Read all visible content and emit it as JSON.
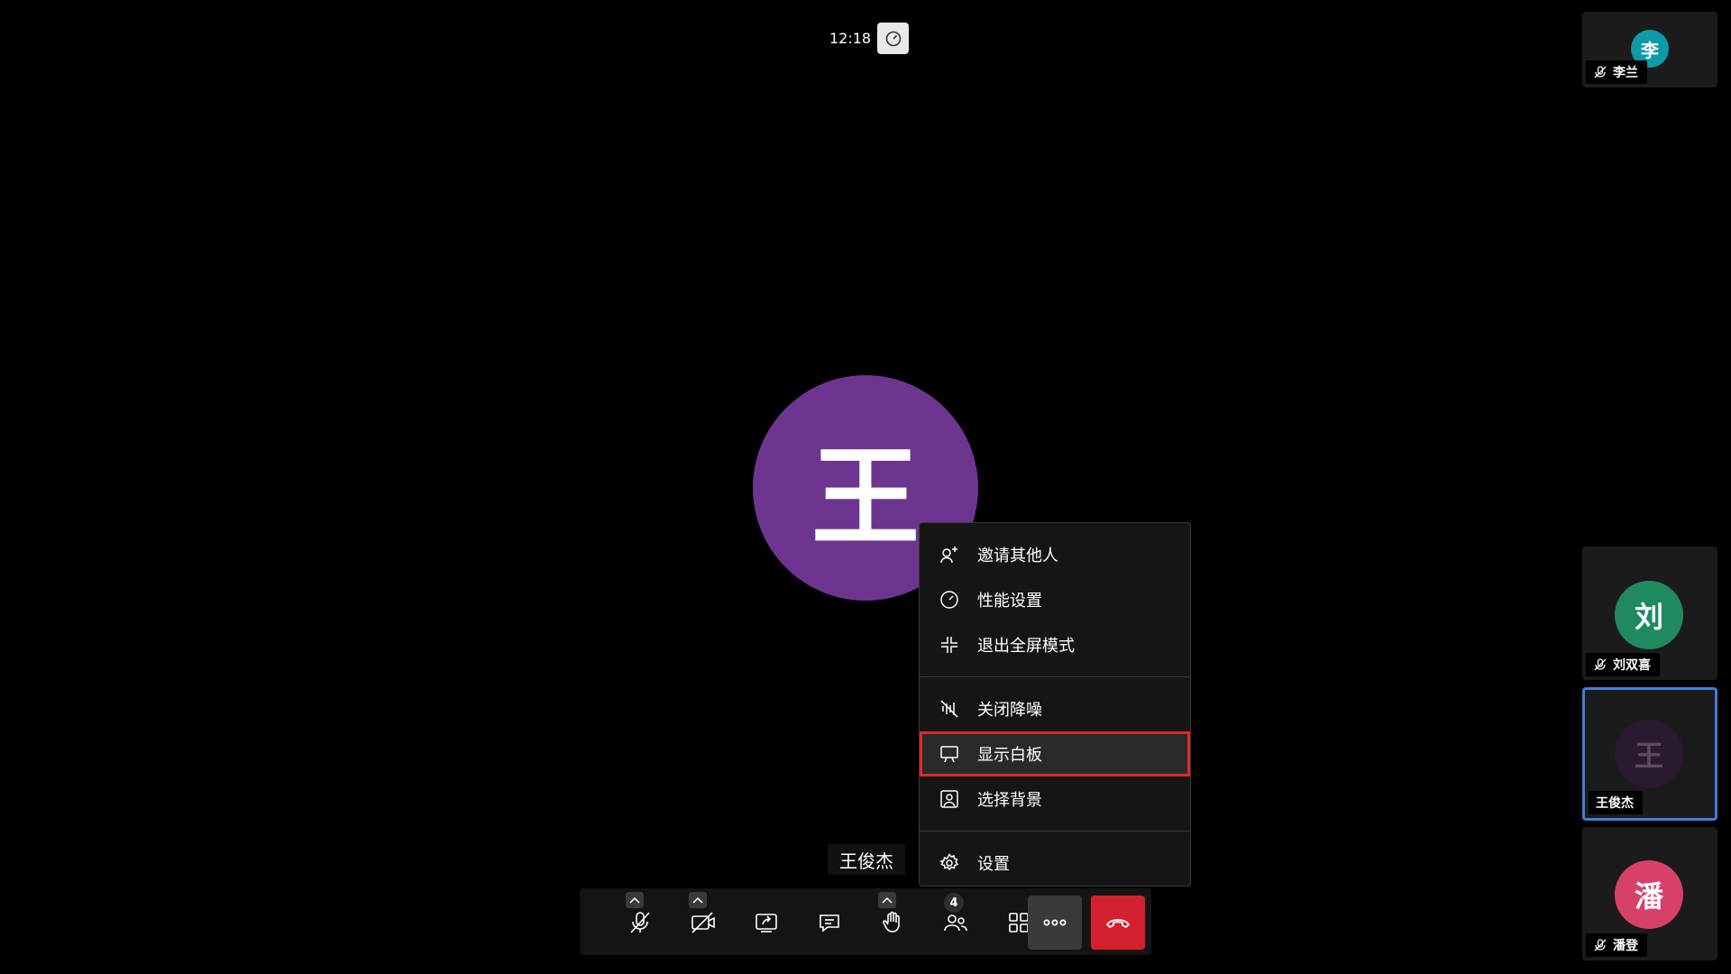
{
  "timer": "12:18",
  "main_speaker": {
    "initial": "王",
    "name": "王俊杰",
    "avatar_color": "#6e3590"
  },
  "menu": {
    "items": [
      {
        "label": "邀请其他人",
        "icon": "add-person-icon"
      },
      {
        "label": "性能设置",
        "icon": "gauge-icon"
      },
      {
        "label": "退出全屏模式",
        "icon": "exit-fullscreen-icon"
      },
      {
        "label": "关闭降噪",
        "icon": "noise-suppression-off-icon"
      },
      {
        "label": "显示白板",
        "icon": "whiteboard-icon",
        "highlighted": true
      },
      {
        "label": "选择背景",
        "icon": "background-image-icon"
      },
      {
        "label": "设置",
        "icon": "gear-icon"
      }
    ]
  },
  "toolbar": {
    "participant_count": "4",
    "buttons": [
      "mic-muted-icon",
      "camera-off-icon",
      "share-screen-icon",
      "chat-icon",
      "raise-hand-icon",
      "participants-icon",
      "layout-grid-icon",
      "more-icon",
      "hang-up-icon"
    ]
  },
  "participants": [
    {
      "name": "李兰",
      "initial": "李",
      "color": "#0e9aa7",
      "muted": true
    },
    {
      "name": "刘双喜",
      "initial": "刘",
      "color": "#1f8a5f",
      "muted": true
    },
    {
      "name": "王俊杰",
      "initial": "王",
      "color": "#2a1a2e",
      "muted": false,
      "active": true
    },
    {
      "name": "潘登",
      "initial": "潘",
      "color": "#d8406c",
      "muted": true
    }
  ],
  "colors": {
    "accent_active": "#3f7ed8",
    "hangup": "#d3202f",
    "highlight_outline": "#e0282a"
  }
}
